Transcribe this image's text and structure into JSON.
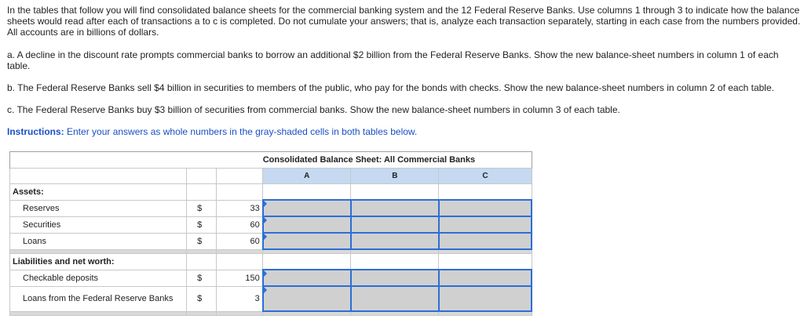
{
  "instructions": {
    "intro": "In the tables that follow you will find consolidated balance sheets for the commercial banking system and the 12 Federal Reserve Banks. Use columns 1 through 3 to indicate how the balance sheets would read after each of transactions a to c is completed. Do not cumulate your answers; that is, analyze each transaction separately, starting in each case from the numbers provided. All accounts are in billions of dollars.",
    "item_a": "a. A decline in the discount rate prompts commercial banks to borrow an additional $2 billion from the Federal Reserve Banks. Show the new balance-sheet numbers in column 1 of each table.",
    "item_b": "b. The Federal Reserve Banks sell $4 billion in securities to members of the public, who pay for the bonds with checks. Show the new balance-sheet numbers in column 2 of each table.",
    "item_c": "c. The Federal Reserve Banks buy $3 billion of securities from commercial banks. Show the new balance-sheet numbers in column 3 of each table.",
    "label": "Instructions:",
    "text": " Enter your answers as whole numbers in the gray-shaded cells in both tables below."
  },
  "table": {
    "title": "Consolidated Balance Sheet: All Commercial Banks",
    "columns": [
      "A",
      "B",
      "C"
    ],
    "assets_label": "Assets:",
    "liabilities_label": "Liabilities and net worth:",
    "currency": "$",
    "rows": [
      {
        "label": "Reserves",
        "value": "33",
        "inputs": [
          "",
          "",
          ""
        ]
      },
      {
        "label": "Securities",
        "value": "60",
        "inputs": [
          "",
          "",
          ""
        ]
      },
      {
        "label": "Loans",
        "value": "60",
        "inputs": [
          "",
          "",
          ""
        ]
      },
      {
        "label": "Checkable deposits",
        "value": "150",
        "inputs": [
          "",
          "",
          ""
        ]
      },
      {
        "label": "Loans from the Federal Reserve Banks",
        "value": "3",
        "inputs": [
          "",
          "",
          ""
        ]
      }
    ]
  }
}
